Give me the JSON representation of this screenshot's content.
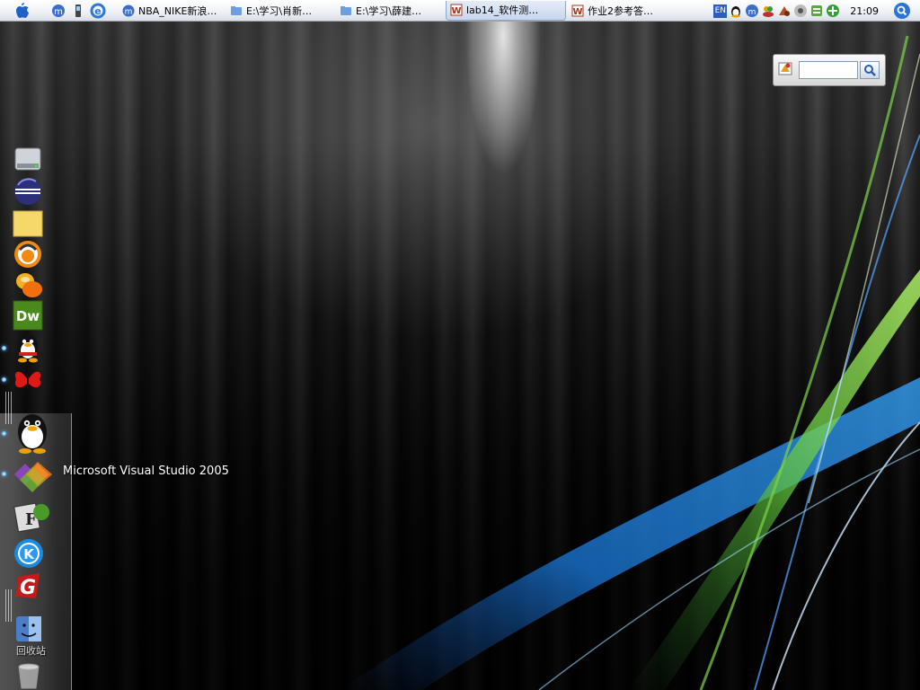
{
  "menubar": {
    "tasks": [
      {
        "label": "NBA_NIKE新浪…",
        "icon": "ie-browser-icon"
      },
      {
        "label": "E:\\学习\\肖新…",
        "icon": "folder-icon"
      },
      {
        "label": "E:\\学习\\薛建…",
        "icon": "folder-icon"
      },
      {
        "label": "lab14_软件测…",
        "icon": "word-document-icon"
      },
      {
        "label": "作业2参考答…",
        "icon": "word-document-icon"
      }
    ],
    "language": "EN",
    "clock": "21:09"
  },
  "search_widget": {
    "value": ""
  },
  "dock": {
    "items": [
      {
        "name": "hard-drive-icon"
      },
      {
        "name": "eclipse-icon"
      },
      {
        "name": "folder-icon"
      },
      {
        "name": "media-player-icon"
      },
      {
        "name": "messenger-icon"
      },
      {
        "name": "dreamweaver-icon",
        "text": "Dw"
      },
      {
        "name": "qq-penguin-icon"
      },
      {
        "name": "butterfly-icon"
      },
      {
        "name": "qq-penguin-large-icon"
      },
      {
        "name": "visual-studio-icon"
      },
      {
        "name": "flash-icon",
        "text": "F"
      },
      {
        "name": "kugou-icon",
        "text": "K"
      },
      {
        "name": "red-g-icon",
        "text": "G"
      },
      {
        "name": "finder-icon"
      },
      {
        "name": "trash-icon"
      }
    ],
    "hover_label": "Microsoft Visual Studio 2005",
    "trash_label": "回收站"
  }
}
